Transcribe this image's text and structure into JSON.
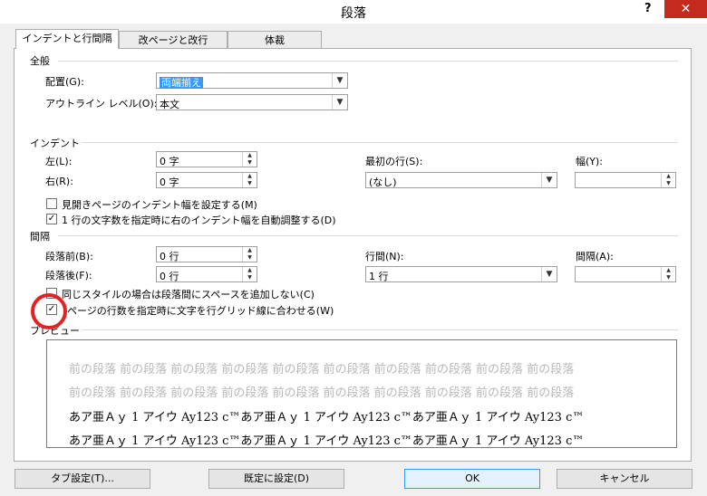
{
  "window": {
    "title": "段落",
    "help": "?",
    "close": "✕"
  },
  "tabs": [
    {
      "label": "インデントと行間隔"
    },
    {
      "label": "改ページと改行"
    },
    {
      "label": "体裁"
    }
  ],
  "general": {
    "header": "全般",
    "alignment_label": "配置(G):",
    "alignment_value": "両端揃え",
    "outline_label": "アウトライン レベル(O):",
    "outline_value": "本文"
  },
  "indent": {
    "header": "インデント",
    "left_label": "左(L):",
    "left_value": "0 字",
    "right_label": "右(R):",
    "right_value": "0 字",
    "first_line_label": "最初の行(S):",
    "first_line_value": "(なし)",
    "width_label": "幅(Y):",
    "width_value": "",
    "mirror_label": "見開きページのインデント幅を設定する(M)",
    "mirror_checked": false,
    "auto_adjust_label": "1 行の文字数を指定時に右のインデント幅を自動調整する(D)",
    "auto_adjust_checked": true
  },
  "spacing": {
    "header": "間隔",
    "before_label": "段落前(B):",
    "before_value": "0 行",
    "after_label": "段落後(F):",
    "after_value": "0 行",
    "line_spacing_label": "行間(N):",
    "line_spacing_value": "1 行",
    "at_label": "間隔(A):",
    "at_value": "",
    "no_space_same_style_label": "同じスタイルの場合は段落間にスペースを追加しない(C)",
    "no_space_same_style_checked": false,
    "snap_to_grid_label": "ページの行数を指定時に文字を行グリッド線に合わせる(W)",
    "snap_to_grid_checked": true
  },
  "preview": {
    "header": "プレビュー",
    "prev_line_1": "前の段落 前の段落 前の段落 前の段落 前の段落 前の段落 前の段落 前の段落 前の段落 前の段落",
    "prev_line_2": "前の段落 前の段落 前の段落 前の段落 前の段落 前の段落 前の段落 前の段落 前の段落 前の段落",
    "sample_line_1": "あア亜Ａｙ 1 アイウ Ay123 c™あア亜Ａｙ 1 アイウ Ay123 c™あア亜Ａｙ 1 アイウ Ay123 c™",
    "sample_line_2": "あア亜Ａｙ 1 アイウ Ay123 c™あア亜Ａｙ 1 アイウ Ay123 c™あア亜Ａｙ 1 アイウ Ay123 c™"
  },
  "buttons": {
    "tabs": "タブ設定(T)...",
    "set_default": "既定に設定(D)",
    "ok": "OK",
    "cancel": "キャンセル"
  },
  "colors": {
    "close": "#c42b1c",
    "selection": "#3399ff",
    "annotation": "#e52222"
  }
}
